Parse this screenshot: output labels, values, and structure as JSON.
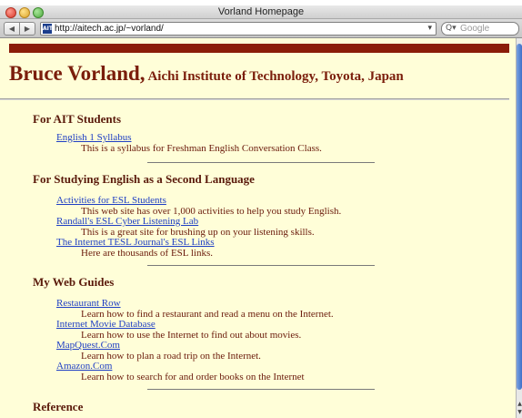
{
  "window": {
    "title": "Vorland Homepage"
  },
  "toolbar": {
    "url": "http://aitech.ac.jp/~vorland/",
    "favicon_text": "AIT",
    "search_placeholder": "Google"
  },
  "page": {
    "name": "Bruce Vorland,",
    "affiliation": " Aichi Institute of Technology, Toyota, Japan",
    "sections": [
      {
        "title": "For AIT Students",
        "items": [
          {
            "link": "English 1 Syllabus",
            "desc": "This is a syllabus for Freshman English Conversation Class."
          }
        ]
      },
      {
        "title": "For Studying English as a Second Language",
        "items": [
          {
            "link": "Activities for ESL Students",
            "desc": "This web site has over 1,000 activities to help you study English."
          },
          {
            "link": "Randall's ESL Cyber Listening Lab",
            "desc": "This is a great site for brushing up on your listening skills."
          },
          {
            "link": "The Internet TESL Journal's ESL Links",
            "desc": "Here are thousands of ESL links."
          }
        ]
      },
      {
        "title": "My Web Guides",
        "items": [
          {
            "link": "Restaurant Row",
            "desc": "Learn how to find a restaurant and read a menu on the Internet."
          },
          {
            "link": "Internet Movie Database",
            "desc": "Learn how to use the Internet to find out about movies."
          },
          {
            "link": "MapQuest.Com",
            "desc": "Learn how to plan a road trip on the Internet."
          },
          {
            "link": "Amazon.Com",
            "desc": "Learn how to search for and order books on the Internet"
          }
        ]
      },
      {
        "title": "Reference",
        "items": []
      }
    ]
  },
  "colors": {
    "page_background": "#fffed8",
    "heading": "#7a1d0b",
    "header_bar": "#8b1d09",
    "link": "#1f3fc4"
  }
}
